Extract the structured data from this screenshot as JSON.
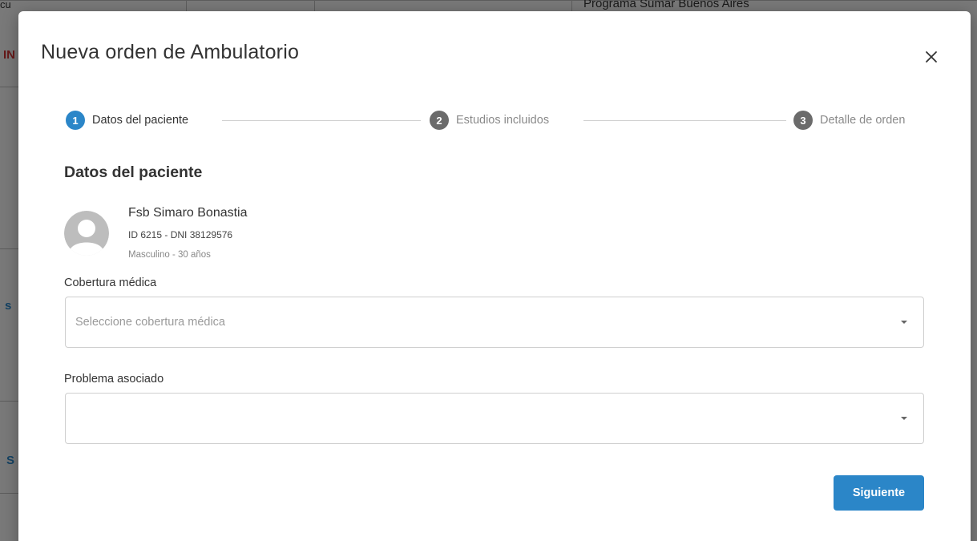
{
  "colors": {
    "accent": "#2b86c8",
    "step_inactive": "#6b6b6b",
    "text_active": "#333333",
    "text_inactive": "#8a8a8a",
    "button_bg": "#2b86c8"
  },
  "background": {
    "top_text": "Programa Sumar Buenos Aires",
    "left_frag_1": "cu",
    "left_frag_2": "IN",
    "left_frag_3": "s",
    "left_frag_4": "S"
  },
  "modal": {
    "title": "Nueva orden de Ambulatorio",
    "close_icon": "close-icon"
  },
  "stepper": {
    "steps": [
      {
        "number": "1",
        "label": "Datos del paciente",
        "state": "active"
      },
      {
        "number": "2",
        "label": "Estudios incluidos",
        "state": "inactive"
      },
      {
        "number": "3",
        "label": "Detalle de orden",
        "state": "inactive"
      }
    ]
  },
  "section": {
    "title": "Datos del paciente"
  },
  "patient": {
    "avatar_icon": "user-avatar-icon",
    "name": "Fsb Simaro Bonastia",
    "id_line": "ID 6215 - DNI 38129576",
    "sex_age": "Masculino - 30 años"
  },
  "form": {
    "coverage": {
      "label": "Cobertura médica",
      "placeholder": "Seleccione cobertura médica",
      "value": ""
    },
    "problem": {
      "label": "Problema asociado",
      "placeholder": "",
      "value": ""
    }
  },
  "actions": {
    "next_label": "Siguiente"
  }
}
